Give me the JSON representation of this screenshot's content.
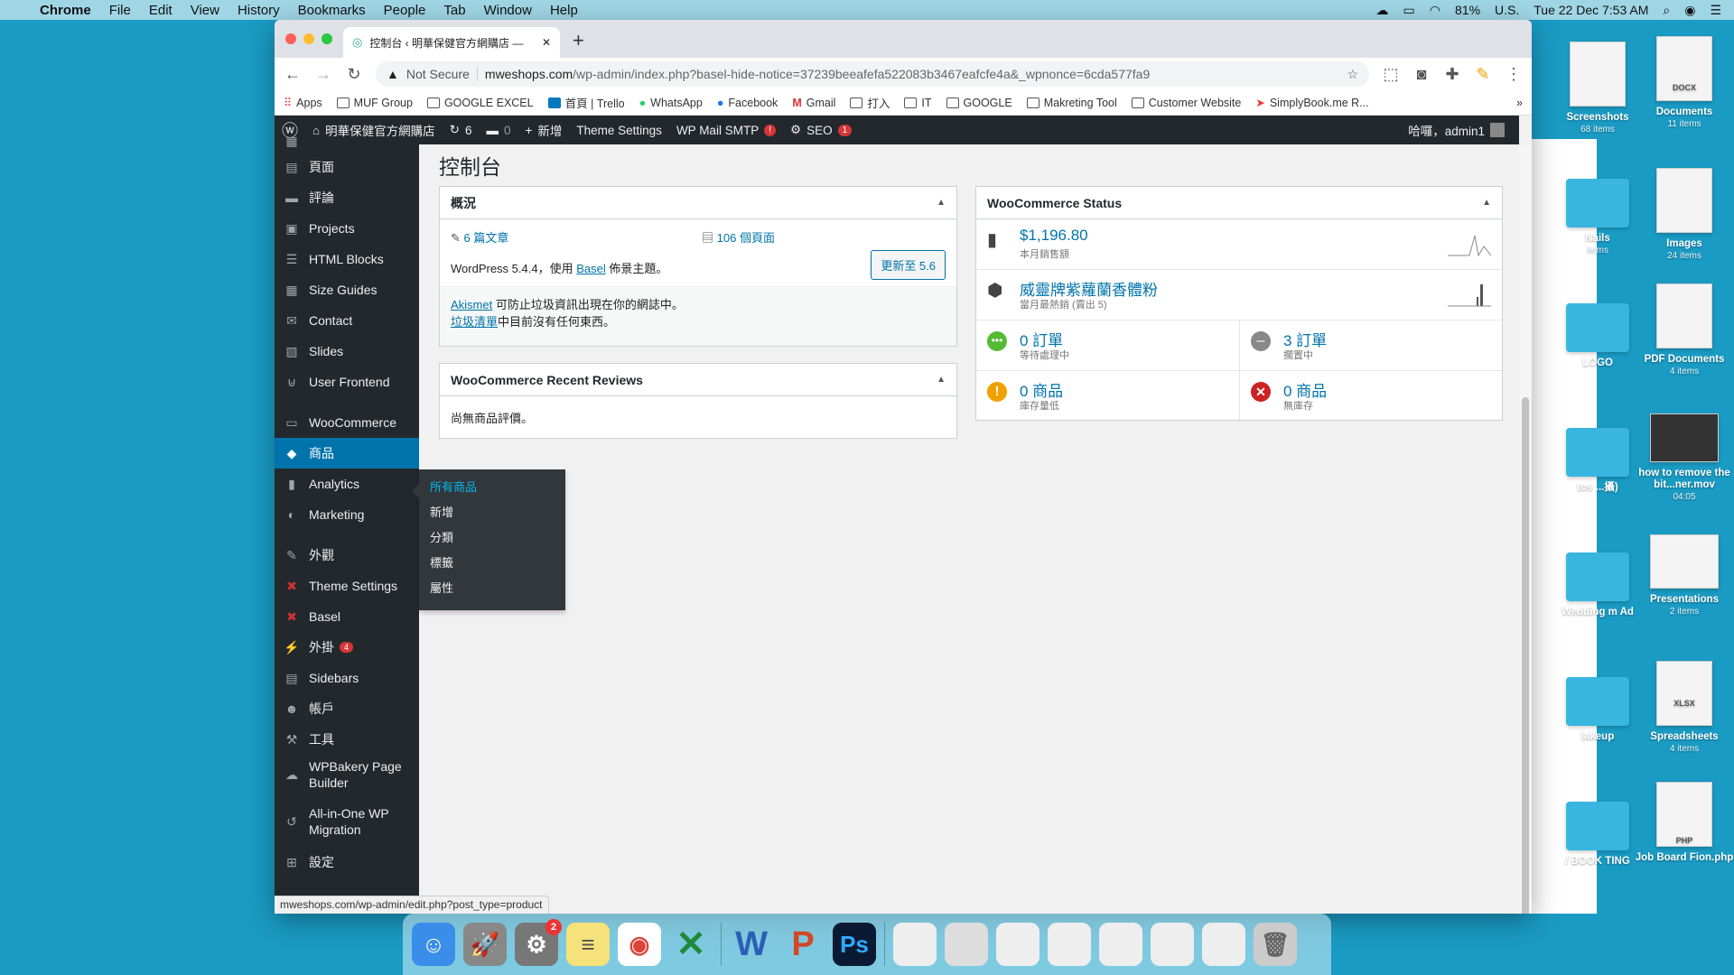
{
  "menubar": {
    "app": "Chrome",
    "items": [
      "File",
      "Edit",
      "View",
      "History",
      "Bookmarks",
      "People",
      "Tab",
      "Window",
      "Help"
    ],
    "battery": "81%",
    "input_source": "U.S.",
    "clock": "Tue 22 Dec  7:53 AM"
  },
  "desktop": [
    {
      "label": "Screenshots",
      "sub": "68 items"
    },
    {
      "label": "Documents",
      "sub": "11 items",
      "doc": "DOCX"
    },
    {
      "label": "Nails",
      "sub": "items"
    },
    {
      "label": "Images",
      "sub": "24 items"
    },
    {
      "label": "LOGO",
      "sub": ""
    },
    {
      "label": "PDF Documents",
      "sub": "4 items"
    },
    {
      "label": "tos ...攝)",
      "sub": ""
    },
    {
      "label": "how to remove the bit...ner.mov",
      "sub": "04:05"
    },
    {
      "label": "Wedding m Ad",
      "sub": ""
    },
    {
      "label": "Presentations",
      "sub": "2 items"
    },
    {
      "label": "lakeup",
      "sub": ""
    },
    {
      "label": "Spreadsheets",
      "sub": "4 items",
      "doc": "XLSX"
    },
    {
      "label": "/ BOOK TING",
      "sub": ""
    },
    {
      "label": "Job Board Fion.php",
      "sub": "",
      "doc": "PHP"
    }
  ],
  "browser": {
    "tab_title": "控制台 ‹ 明華保健官方網購店 —",
    "not_secure": "Not Secure",
    "url_host": "mweshops.com",
    "url_path": "/wp-admin/index.php?basel-hide-notice=37239beeafefa522083b3467eafcfe4a&_wpnonce=6cda577fa9",
    "bookmarks": [
      "Apps",
      "MUF Group",
      "GOOGLE EXCEL",
      "首頁 | Trello",
      "WhatsApp",
      "Facebook",
      "Gmail",
      "打入",
      "IT",
      "GOOGLE",
      "Makreting Tool",
      "Customer Website",
      "SimplyBook.me R..."
    ],
    "status_url": "mweshops.com/wp-admin/edit.php?post_type=product"
  },
  "adminbar": {
    "site": "明華保健官方網購店",
    "updates": "6",
    "comments": "0",
    "new": "新增",
    "theme_settings": "Theme Settings",
    "smtp": "WP Mail SMTP",
    "smtp_badge": "!",
    "seo": "SEO",
    "seo_badge": "1",
    "howdy": "哈囉，admin1"
  },
  "sidebar": {
    "items": [
      {
        "label": "頁面",
        "icon": "pages-icon"
      },
      {
        "label": "評論",
        "icon": "comments-icon"
      },
      {
        "label": "Projects",
        "icon": "projects-icon"
      },
      {
        "label": "HTML Blocks",
        "icon": "html-blocks-icon"
      },
      {
        "label": "Size Guides",
        "icon": "size-guides-icon"
      },
      {
        "label": "Contact",
        "icon": "mail-icon"
      },
      {
        "label": "Slides",
        "icon": "slides-icon"
      },
      {
        "label": "User Frontend",
        "icon": "user-frontend-icon"
      },
      {
        "label": "WooCommerce",
        "icon": "woocommerce-icon"
      },
      {
        "label": "商品",
        "icon": "products-icon"
      },
      {
        "label": "Analytics",
        "icon": "analytics-icon"
      },
      {
        "label": "Marketing",
        "icon": "marketing-icon"
      },
      {
        "label": "外觀",
        "icon": "appearance-icon"
      },
      {
        "label": "Theme Settings",
        "icon": "theme-settings-icon"
      },
      {
        "label": "Basel",
        "icon": "basel-icon"
      },
      {
        "label": "外掛",
        "icon": "plugins-icon",
        "count": "4"
      },
      {
        "label": "Sidebars",
        "icon": "sidebars-icon"
      },
      {
        "label": "帳戶",
        "icon": "users-icon"
      },
      {
        "label": "工具",
        "icon": "tools-icon"
      },
      {
        "label": "WPBakery Page Builder",
        "icon": "wpbakery-icon"
      },
      {
        "label": "All-in-One WP Migration",
        "icon": "migration-icon"
      },
      {
        "label": "設定",
        "icon": "settings-icon"
      }
    ],
    "flyout": [
      "所有商品",
      "新增",
      "分類",
      "標籤",
      "屬性"
    ]
  },
  "dashboard": {
    "title": "控制台",
    "overview": {
      "heading": "概況",
      "posts": "6 篇文章",
      "pages": "106 個頁面",
      "wp_text_pre": "WordPress 5.4.4，使用",
      "theme": "Basel",
      "wp_text_post": "佈景主題。",
      "update_btn": "更新至 5.6",
      "akismet": "Akismet",
      "akismet_text": "可防止垃圾資訊出現在你的網誌中。",
      "spam_link": "垃圾清單",
      "spam_text": "中目前沒有任何東西。"
    },
    "reviews": {
      "heading": "WooCommerce Recent Reviews",
      "empty": "尚無商品評價。"
    },
    "wc_status": {
      "heading": "WooCommerce Status",
      "sales_value": "$1,196.80",
      "sales_label": "本月銷售額",
      "top_product": "威靈牌紫蘿蘭香體粉",
      "top_label": "當月最熱銷 (賣出 5)",
      "processing": "0 訂單",
      "processing_label": "等待處理中",
      "onhold": "3 訂單",
      "onhold_label": "擱置中",
      "lowstock": "0 商品",
      "lowstock_label": "庫存量低",
      "outstock": "0 商品",
      "outstock_label": "無庫存"
    }
  },
  "colors": {
    "wp_dark": "#23282d",
    "wp_blue": "#0073aa",
    "desktop": "#1a9bc4"
  }
}
